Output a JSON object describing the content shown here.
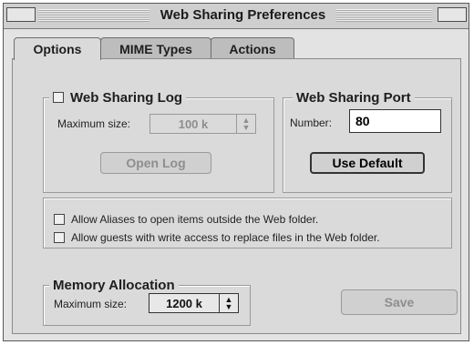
{
  "window": {
    "title": "Web Sharing Preferences"
  },
  "tabs": [
    {
      "label": "Options"
    },
    {
      "label": "MIME Types"
    },
    {
      "label": "Actions"
    }
  ],
  "web_sharing_log": {
    "legend": "Web Sharing Log",
    "checked": false,
    "max_size_label": "Maximum size:",
    "max_size_value": "100 k",
    "open_log_label": "Open Log"
  },
  "web_sharing_port": {
    "legend": "Web Sharing Port",
    "number_label": "Number:",
    "number_value": "80",
    "use_default_label": "Use Default"
  },
  "options": {
    "allow_aliases_label": "Allow Aliases to open items outside the Web folder.",
    "allow_guests_label": "Allow guests with write access to replace files in the Web folder."
  },
  "memory_allocation": {
    "legend": "Memory Allocation",
    "max_size_label": "Maximum size:",
    "max_size_value": "1200 k"
  },
  "save_label": "Save"
}
